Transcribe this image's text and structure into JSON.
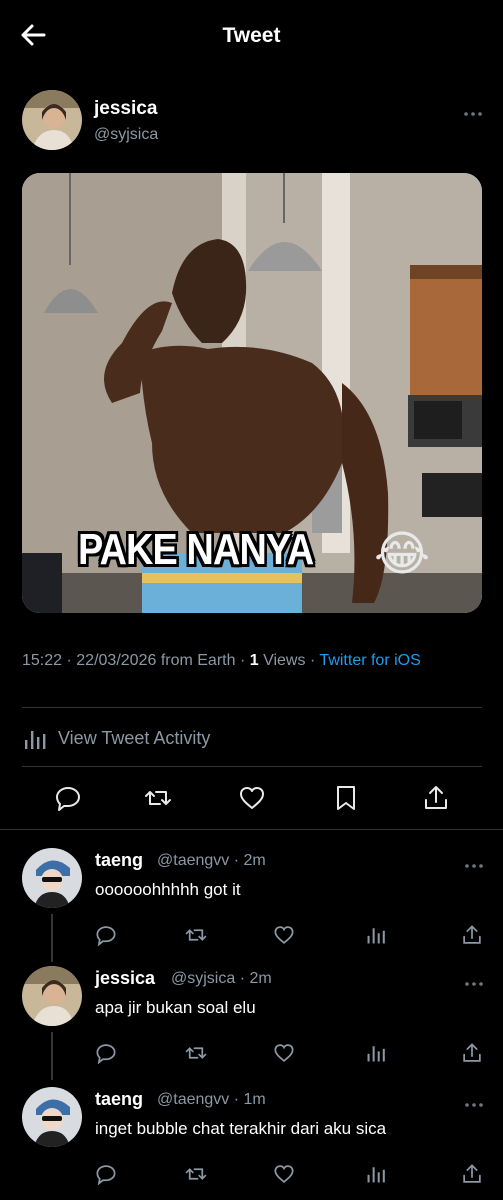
{
  "header": {
    "title": "Tweet",
    "back_icon": "arrow-left-icon"
  },
  "tweet": {
    "author_name": "jessica",
    "author_handle": "@syjsica",
    "media_caption": "PAKE NANYA",
    "media_emoji": "😂",
    "time": "15:22",
    "date": "22/03/2026",
    "location": "from Earth",
    "views_count": "1",
    "views_label": "Views",
    "client": "Twitter for iOS",
    "activity_label": "View Tweet Activity",
    "actions": [
      "reply-icon",
      "retweet-icon",
      "like-icon",
      "bookmark-icon",
      "share-icon"
    ]
  },
  "replies": [
    {
      "name": "taeng",
      "handle": "@taengvv",
      "time": "2m",
      "text": "oooooohhhhh got it"
    },
    {
      "name": "jessica",
      "handle": "@syjsica",
      "time": "2m",
      "text": "apa jir bukan soal elu"
    },
    {
      "name": "taeng",
      "handle": "@taengvv",
      "time": "1m",
      "text": "inget bubble chat terakhir dari aku sica"
    }
  ],
  "colors": {
    "background": "#000000",
    "text": "#e7e9ea",
    "secondary": "#8b98a5",
    "link": "#1d9bf0",
    "divider": "#2f3336"
  }
}
